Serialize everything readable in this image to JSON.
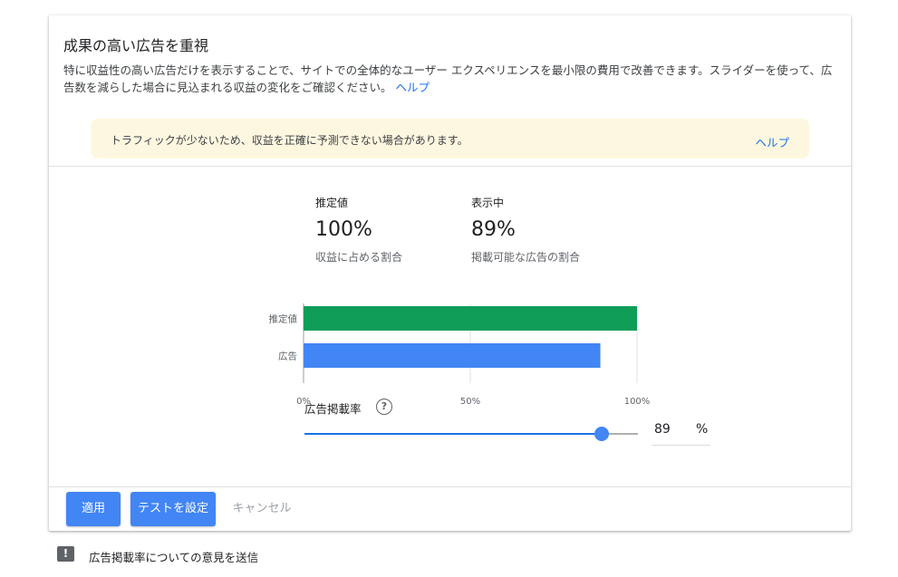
{
  "header": {
    "title": "成果の高い広告を重視",
    "description": "特に収益性の高い広告だけを表示することで、サイトでの全体的なユーザー エクスペリエンスを最小限の費用で改善できます。スライダーを使って、広告数を減らした場合に見込まれる収益の変化をご確認ください。",
    "help_link": "ヘルプ"
  },
  "warning": {
    "text": "トラフィックが少ないため、収益を正確に予測できない場合があります。",
    "help_link": "ヘルプ"
  },
  "stats": {
    "estimate": {
      "label": "推定値",
      "value": "100%",
      "sub": "収益に占める割合"
    },
    "showing": {
      "label": "表示中",
      "value": "89%",
      "sub": "掲載可能な広告の割合"
    }
  },
  "chart_data": {
    "type": "bar",
    "orientation": "horizontal",
    "categories": [
      "推定値",
      "広告"
    ],
    "values": [
      100,
      89
    ],
    "colors": [
      "#0f9d58",
      "#4285f4"
    ],
    "xticks": [
      "0%",
      "50%",
      "100%"
    ],
    "xlim": [
      0,
      100
    ],
    "grid": true
  },
  "slider": {
    "label": "広告掲載率",
    "help_icon": "question-circle-icon",
    "value": 89,
    "min": 0,
    "max": 100,
    "display_value": "89",
    "unit": "%"
  },
  "actions": {
    "apply": "適用",
    "test": "テストを設定",
    "cancel": "キャンセル"
  },
  "feedback": {
    "icon": "feedback-icon",
    "text": "広告掲載率についての意見を送信"
  },
  "colors": {
    "accent": "#1a73e8",
    "button": "#4285f4",
    "warning_bg": "#fef7e0",
    "estimate_bar": "#0f9d58",
    "ad_bar": "#4285f4"
  }
}
